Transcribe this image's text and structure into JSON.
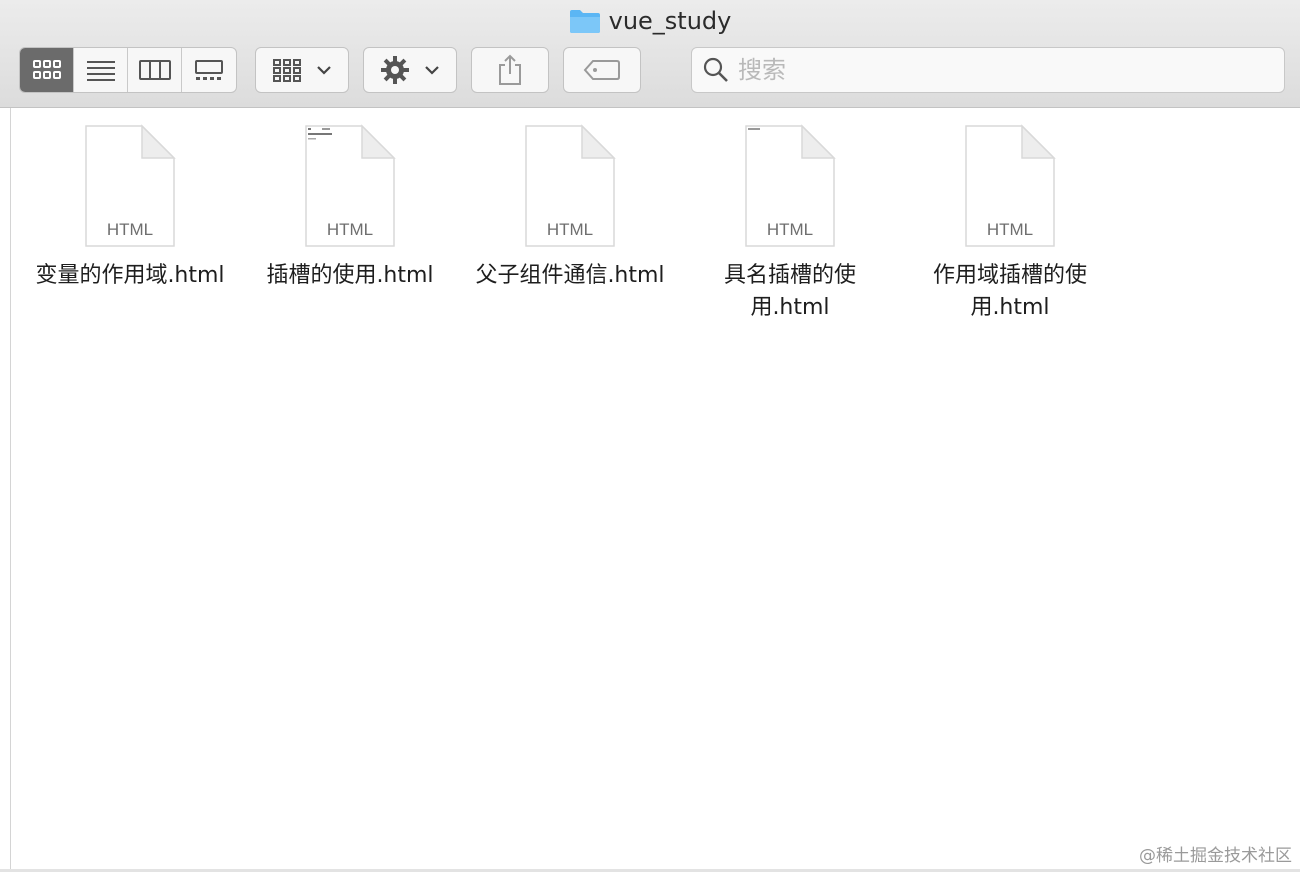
{
  "window": {
    "title": "vue_study"
  },
  "toolbar": {
    "view_modes": [
      {
        "name": "icon-view",
        "active": true
      },
      {
        "name": "list-view",
        "active": false
      },
      {
        "name": "column-view",
        "active": false
      },
      {
        "name": "gallery-view",
        "active": false
      }
    ],
    "search_placeholder": "搜索"
  },
  "files": [
    {
      "name": "变量的作用域.html",
      "type_label": "HTML"
    },
    {
      "name": "插槽的使用.html",
      "type_label": "HTML"
    },
    {
      "name": "父子组件通信.html",
      "type_label": "HTML"
    },
    {
      "name": "具名插槽的使用.html",
      "type_label": "HTML"
    },
    {
      "name": "作用域插槽的使用.html",
      "type_label": "HTML"
    }
  ],
  "watermark": "@稀土掘金技术社区",
  "colors": {
    "active_view": "#6b6b6b",
    "folder": "#5bb6f4"
  }
}
